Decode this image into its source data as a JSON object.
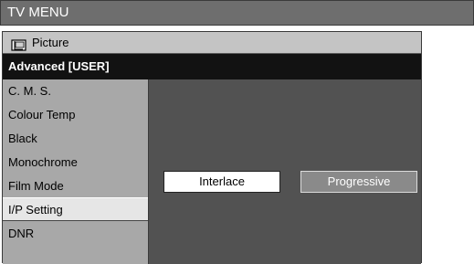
{
  "window": {
    "title": "TV MENU"
  },
  "picture": {
    "label": "Picture",
    "icon": "picture-icon"
  },
  "advanced": {
    "label": "Advanced [USER]"
  },
  "menu": {
    "items": [
      {
        "label": "C. M. S."
      },
      {
        "label": "Colour Temp"
      },
      {
        "label": "Black"
      },
      {
        "label": "Monochrome"
      },
      {
        "label": "Film Mode"
      },
      {
        "label": "I/P Setting",
        "selected": true
      },
      {
        "label": "DNR"
      }
    ]
  },
  "ip_setting": {
    "options": [
      {
        "label": "Interlace",
        "highlighted": true
      },
      {
        "label": "Progressive",
        "highlighted": false
      }
    ]
  },
  "colors": {
    "titlebar": "#6e6e6e",
    "header_dark": "#121212",
    "content_bg": "#525252",
    "selected_item": "#e6e6e6"
  }
}
